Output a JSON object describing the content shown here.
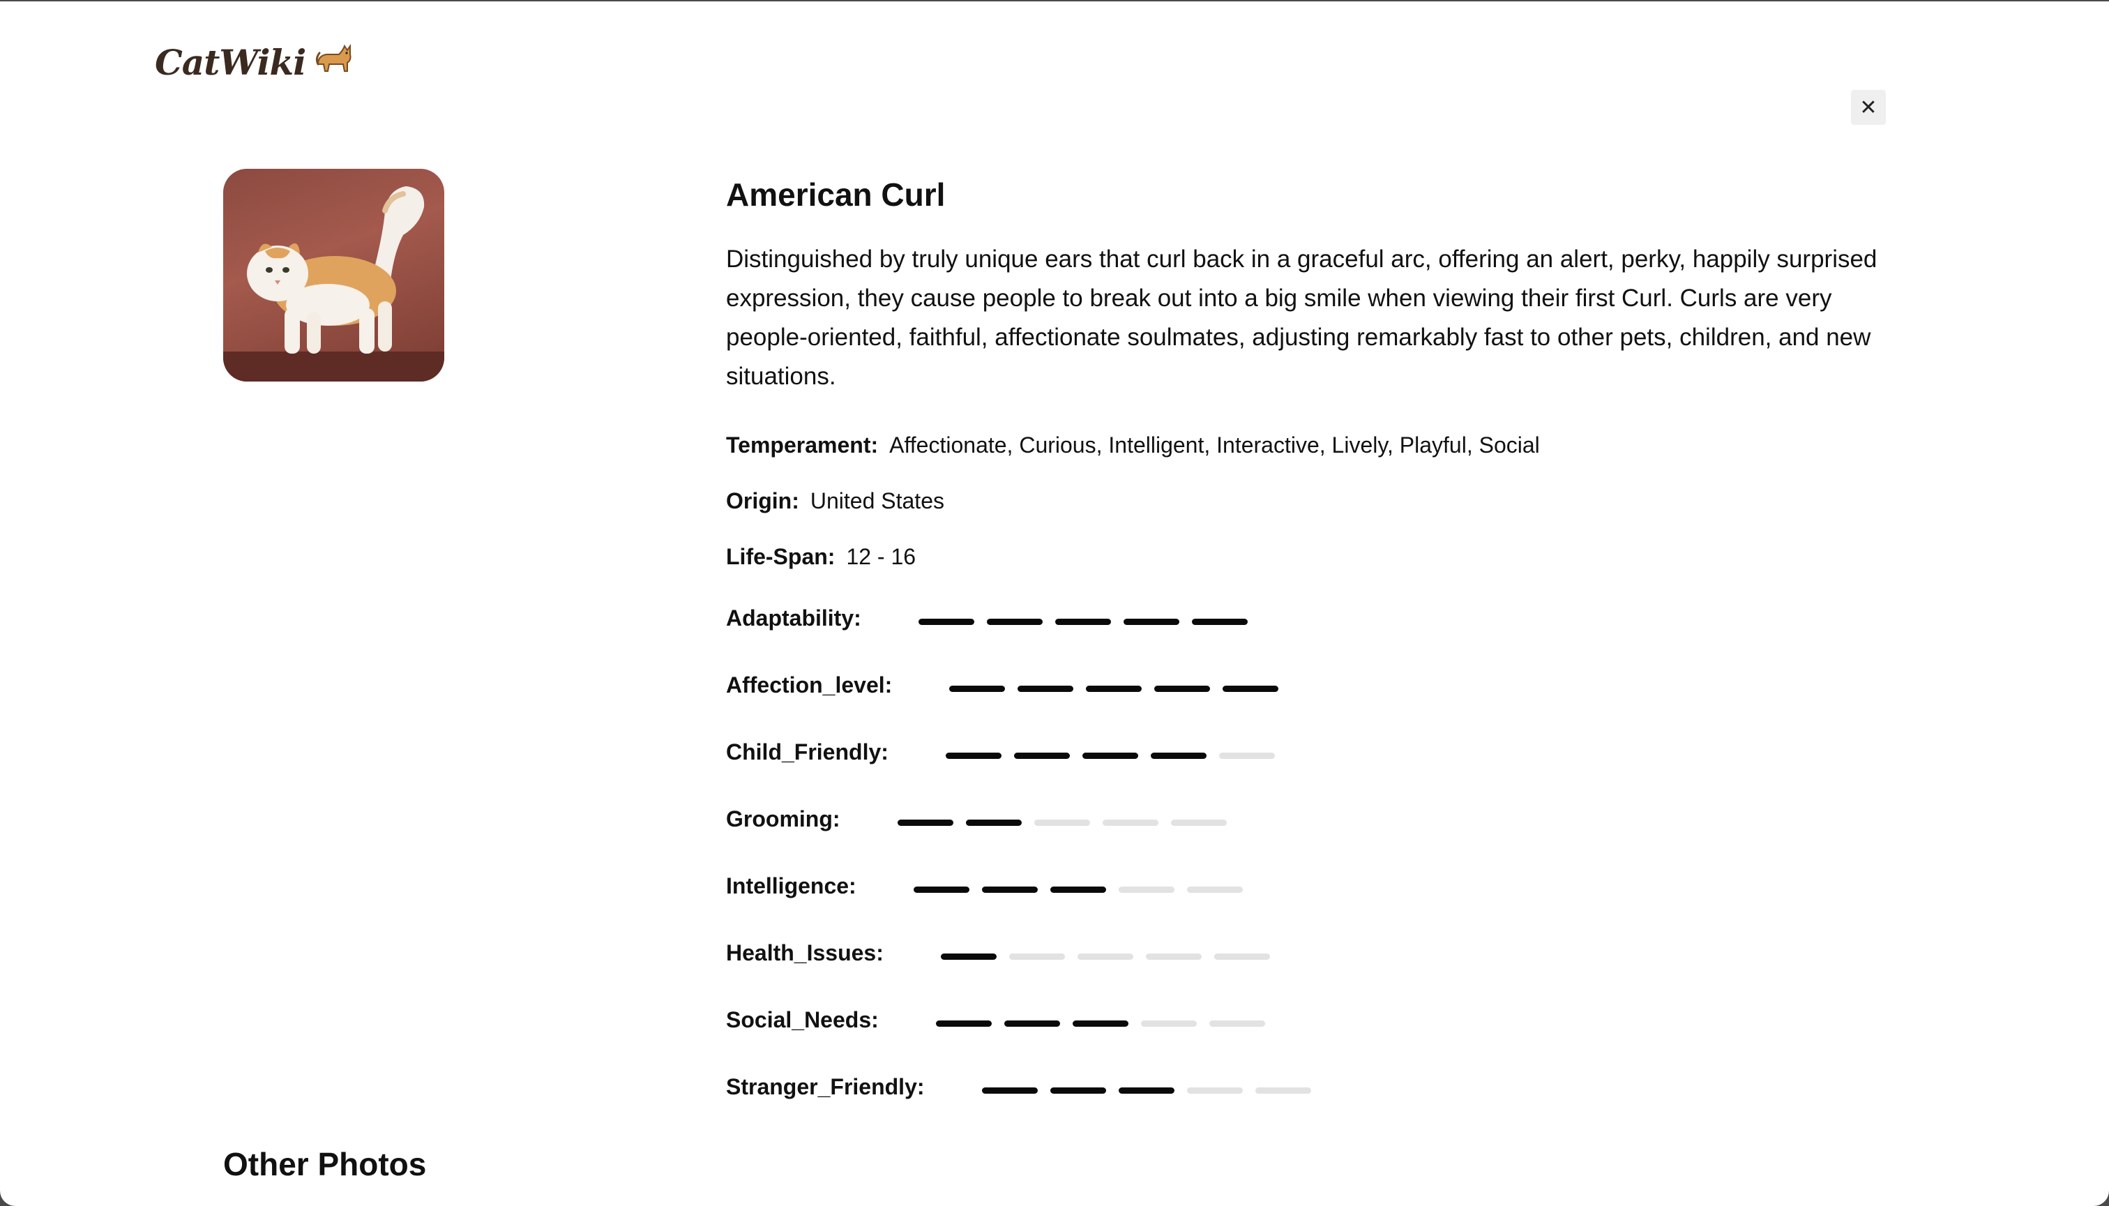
{
  "header": {
    "logo_text": "CatWiki",
    "logo_icon": "cat-icon",
    "close_label": "✕"
  },
  "breed": {
    "name": "American Curl",
    "description": "Distinguished by truly unique ears that curl back in a graceful arc, offering an alert, perky, happily surprised expression, they cause people to break out into a big smile when viewing their first Curl. Curls are very people-oriented, faithful, affectionate soulmates, adjusting remarkably fast to other pets, children, and new situations.",
    "temperament_label": "Temperament:",
    "temperament": "Affectionate, Curious, Intelligent, Interactive, Lively, Playful, Social",
    "origin_label": "Origin:",
    "origin": "United States",
    "lifespan_label": "Life-Span:",
    "lifespan": "12 - 16"
  },
  "stats": [
    {
      "label": "Adaptability:",
      "level": 5,
      "max": 5
    },
    {
      "label": "Affection_level:",
      "level": 5,
      "max": 5
    },
    {
      "label": "Child_Friendly:",
      "level": 4,
      "max": 5
    },
    {
      "label": "Grooming:",
      "level": 2,
      "max": 5
    },
    {
      "label": "Intelligence:",
      "level": 3,
      "max": 5
    },
    {
      "label": "Health_Issues:",
      "level": 1,
      "max": 5
    },
    {
      "label": "Social_Needs:",
      "level": 3,
      "max": 5
    },
    {
      "label": "Stranger_Friendly:",
      "level": 3,
      "max": 5
    }
  ],
  "other_photos_heading": "Other Photos",
  "colors": {
    "bar_active": "#0a0a0a",
    "bar_inactive": "#e2e2e2"
  }
}
